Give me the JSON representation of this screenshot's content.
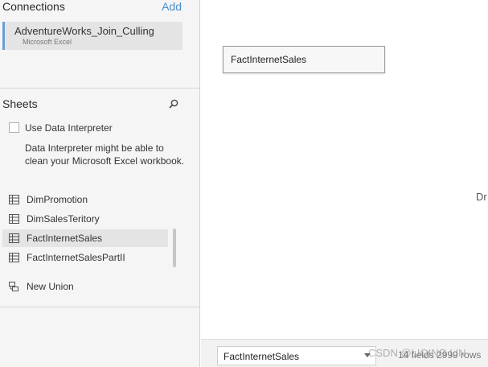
{
  "connections": {
    "title": "Connections",
    "add_label": "Add",
    "item": {
      "name": "AdventureWorks_Join_Culling",
      "type": "Microsoft Excel"
    }
  },
  "sheets": {
    "title": "Sheets",
    "use_interpreter_label": "Use Data Interpreter",
    "interpreter_desc": "Data Interpreter might be able to clean your Microsoft Excel workbook.",
    "items": [
      {
        "label": "DimPromotion",
        "icon": "table-icon"
      },
      {
        "label": "DimSalesTeritory",
        "icon": "table-icon"
      },
      {
        "label": "FactInternetSales",
        "icon": "table-icon",
        "selected": true
      },
      {
        "label": "FactInternetSalesPartII",
        "icon": "table-icon"
      }
    ],
    "new_union_label": "New Union"
  },
  "canvas": {
    "table_label": "FactInternetSales",
    "hint_text": "Dr"
  },
  "bottom": {
    "selected_table": "FactInternetSales",
    "summary": "14 fields 2999 rows",
    "watermark": "CSDN @LIQING LIN"
  },
  "colors": {
    "accent": "#4a8fcb",
    "selection": "#e4e4e4",
    "pane_bg": "#f5f5f5"
  }
}
